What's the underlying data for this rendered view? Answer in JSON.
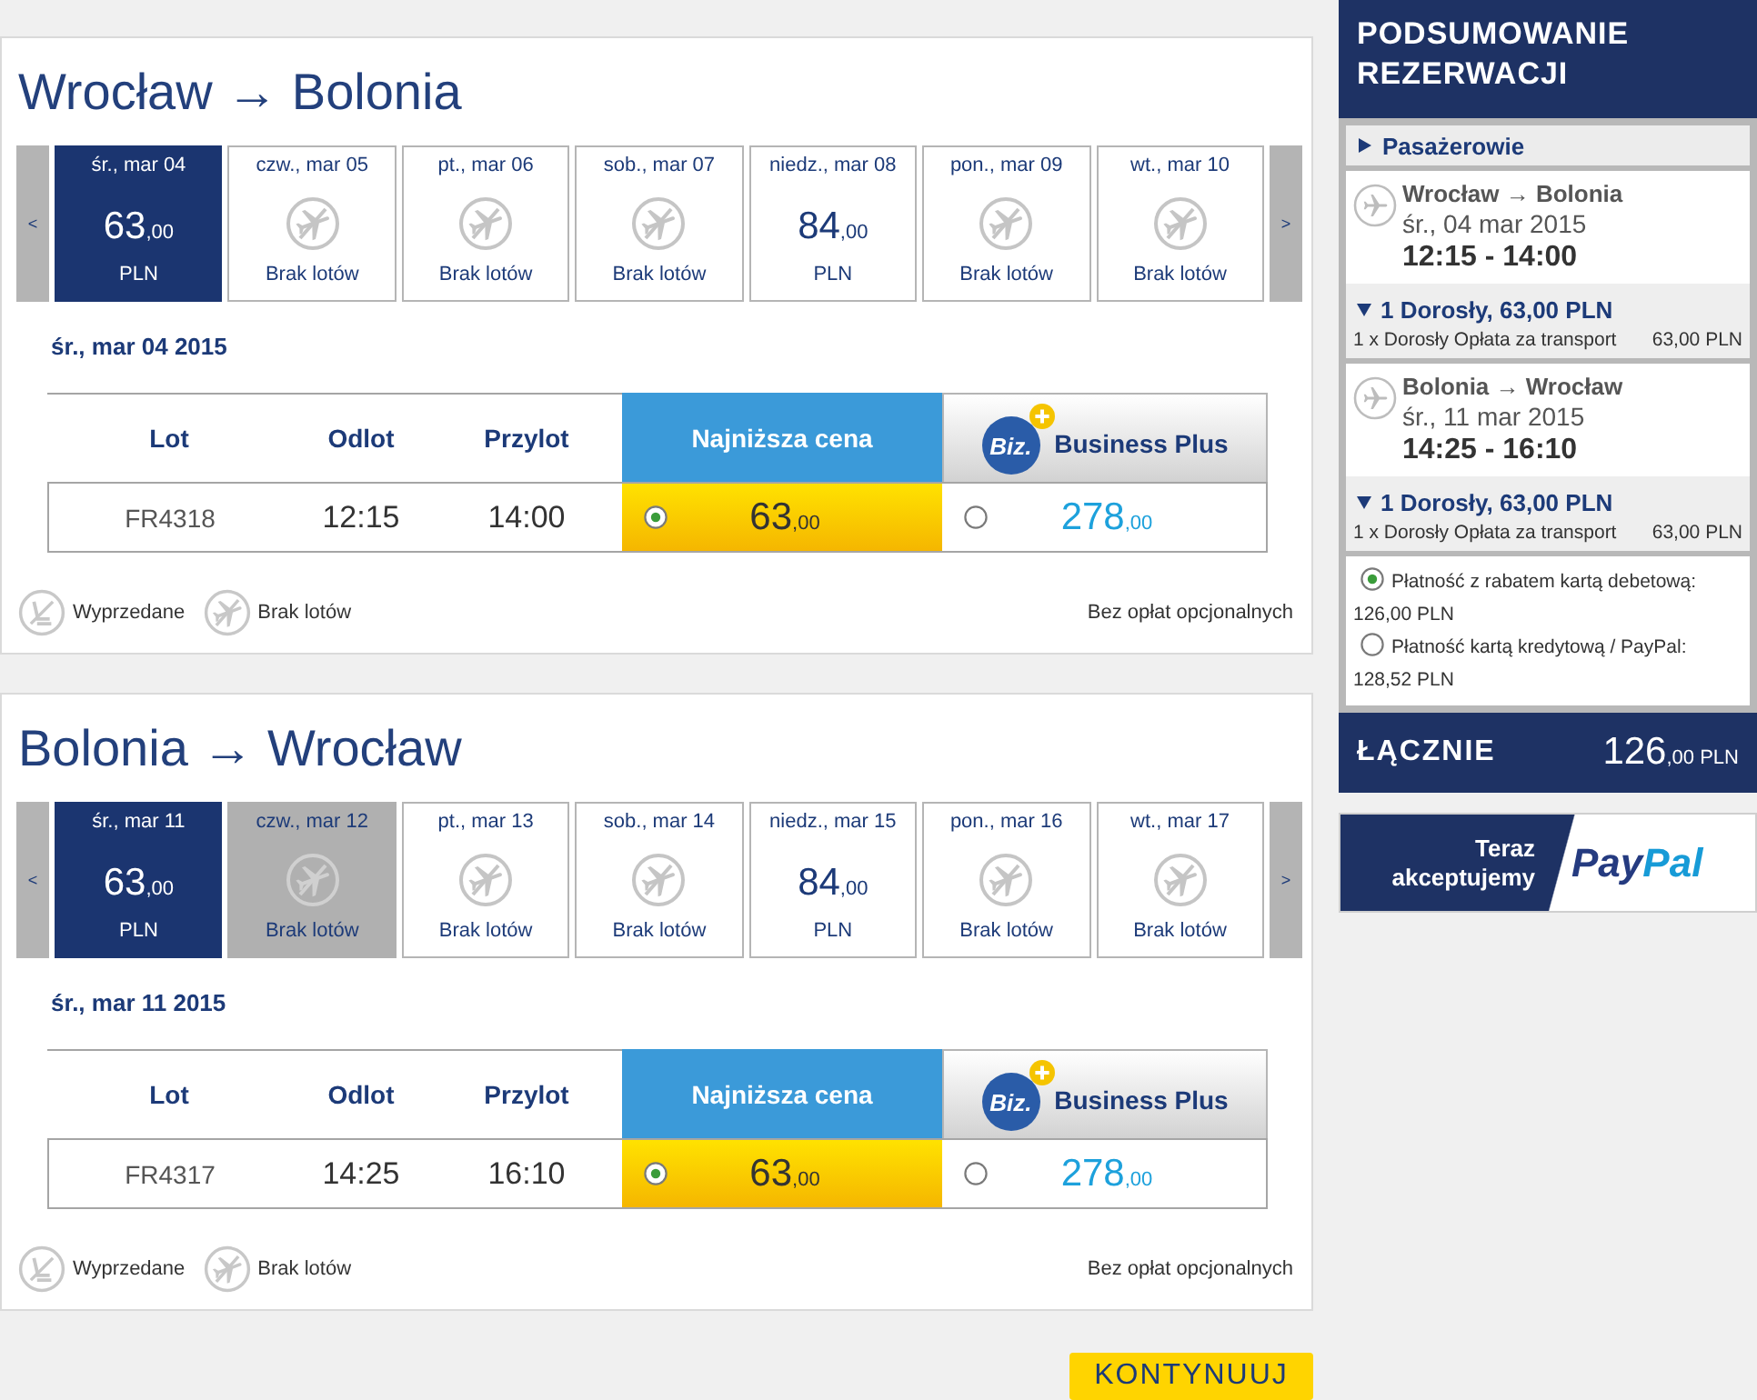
{
  "flights": [
    {
      "title": "Wrocław → Bolonia",
      "prev_arrow": "<",
      "next_arrow": ">",
      "dates": [
        {
          "label": "śr., mar 04",
          "kind": "price",
          "selected": true,
          "disabled": false,
          "amount": "63",
          "decimals": ",00",
          "currency": "PLN"
        },
        {
          "label": "czw., mar 05",
          "kind": "no_flights",
          "selected": false,
          "disabled": false,
          "note": "Brak lotów"
        },
        {
          "label": "pt., mar 06",
          "kind": "no_flights",
          "selected": false,
          "disabled": false,
          "note": "Brak lotów"
        },
        {
          "label": "sob., mar 07",
          "kind": "no_flights",
          "selected": false,
          "disabled": false,
          "note": "Brak lotów"
        },
        {
          "label": "niedz., mar 08",
          "kind": "price",
          "selected": false,
          "disabled": false,
          "amount": "84",
          "decimals": ",00",
          "currency": "PLN"
        },
        {
          "label": "pon., mar 09",
          "kind": "no_flights",
          "selected": false,
          "disabled": false,
          "note": "Brak lotów"
        },
        {
          "label": "wt., mar 10",
          "kind": "no_flights",
          "selected": false,
          "disabled": false,
          "note": "Brak lotów"
        }
      ],
      "day_heading": "śr., mar 04 2015",
      "table": {
        "columns": [
          {
            "label": "Lot",
            "kind": "plain"
          },
          {
            "label": "Odlot",
            "kind": "plain"
          },
          {
            "label": "Przylot",
            "kind": "plain"
          },
          {
            "label": "Najniższa cena",
            "kind": "fare"
          },
          {
            "label": "Business Plus",
            "kind": "business",
            "badge": "Biz."
          }
        ],
        "rows": [
          {
            "cells": [
              "FR4318",
              "12:15",
              "14:00"
            ],
            "fares": [
              {
                "selected": true,
                "amount": "63",
                "decimals": ",00"
              },
              {
                "selected": false,
                "amount": "278",
                "decimals": ",00"
              }
            ]
          }
        ]
      },
      "legend": [
        {
          "kind": "sold_out",
          "label": "Wyprzedane"
        },
        {
          "kind": "no_flights",
          "label": "Brak lotów"
        }
      ],
      "note": "Bez opłat opcjonalnych"
    },
    {
      "title": "Bolonia → Wrocław",
      "prev_arrow": "<",
      "next_arrow": ">",
      "dates": [
        {
          "label": "śr., mar 11",
          "kind": "price",
          "selected": true,
          "disabled": false,
          "amount": "63",
          "decimals": ",00",
          "currency": "PLN"
        },
        {
          "label": "czw., mar 12",
          "kind": "no_flights",
          "selected": false,
          "disabled": true,
          "note": "Brak lotów"
        },
        {
          "label": "pt., mar 13",
          "kind": "no_flights",
          "selected": false,
          "disabled": false,
          "note": "Brak lotów"
        },
        {
          "label": "sob., mar 14",
          "kind": "no_flights",
          "selected": false,
          "disabled": false,
          "note": "Brak lotów"
        },
        {
          "label": "niedz., mar 15",
          "kind": "price",
          "selected": false,
          "disabled": false,
          "amount": "84",
          "decimals": ",00",
          "currency": "PLN"
        },
        {
          "label": "pon., mar 16",
          "kind": "no_flights",
          "selected": false,
          "disabled": false,
          "note": "Brak lotów"
        },
        {
          "label": "wt., mar 17",
          "kind": "no_flights",
          "selected": false,
          "disabled": false,
          "note": "Brak lotów"
        }
      ],
      "day_heading": "śr., mar 11 2015",
      "table": {
        "columns": [
          {
            "label": "Lot",
            "kind": "plain"
          },
          {
            "label": "Odlot",
            "kind": "plain"
          },
          {
            "label": "Przylot",
            "kind": "plain"
          },
          {
            "label": "Najniższa cena",
            "kind": "fare"
          },
          {
            "label": "Business Plus",
            "kind": "business",
            "badge": "Biz."
          }
        ],
        "rows": [
          {
            "cells": [
              "FR4317",
              "14:25",
              "16:10"
            ],
            "fares": [
              {
                "selected": true,
                "amount": "63",
                "decimals": ",00"
              },
              {
                "selected": false,
                "amount": "278",
                "decimals": ",00"
              }
            ]
          }
        ]
      },
      "legend": [
        {
          "kind": "sold_out",
          "label": "Wyprzedane"
        },
        {
          "kind": "no_flights",
          "label": "Brak lotów"
        }
      ],
      "note": "Bez opłat opcjonalnych"
    }
  ],
  "continue_button": "KONTYNUUJ",
  "summary": {
    "title": "PODSUMOWANIE REZERWACJI",
    "passengers": {
      "label": "Pasażerowie",
      "expanded": false
    },
    "legs": [
      {
        "route": "Wrocław → Bolonia",
        "date": "śr., 04 mar 2015",
        "times": "12:15 - 14:00",
        "fare": {
          "label": "1 Dorosły, 63,00 PLN",
          "expanded": true,
          "lines": [
            {
              "description": "1 x Dorosły Opłata za transport",
              "amount": "63,00 PLN"
            }
          ]
        }
      },
      {
        "route": "Bolonia → Wrocław",
        "date": "śr., 11 mar 2015",
        "times": "14:25 - 16:10",
        "fare": {
          "label": "1 Dorosły, 63,00 PLN",
          "expanded": true,
          "lines": [
            {
              "description": "1 x Dorosły Opłata za transport",
              "amount": "63,00 PLN"
            }
          ]
        }
      }
    ],
    "payment_options": [
      {
        "label": "Płatność z rabatem kartą debetową:",
        "amount": "126,00 PLN",
        "selected": true
      },
      {
        "label": "Płatność kartą kredytową / PayPal:",
        "amount": "128,52 PLN",
        "selected": false
      }
    ],
    "total": {
      "label": "ŁĄCZNIE",
      "amount": "126",
      "decimals": ",00",
      "currency": "PLN"
    },
    "paypal_banner": {
      "text": "Teraz akceptujemy",
      "logo_parts": [
        "Pay",
        "Pal"
      ]
    }
  }
}
